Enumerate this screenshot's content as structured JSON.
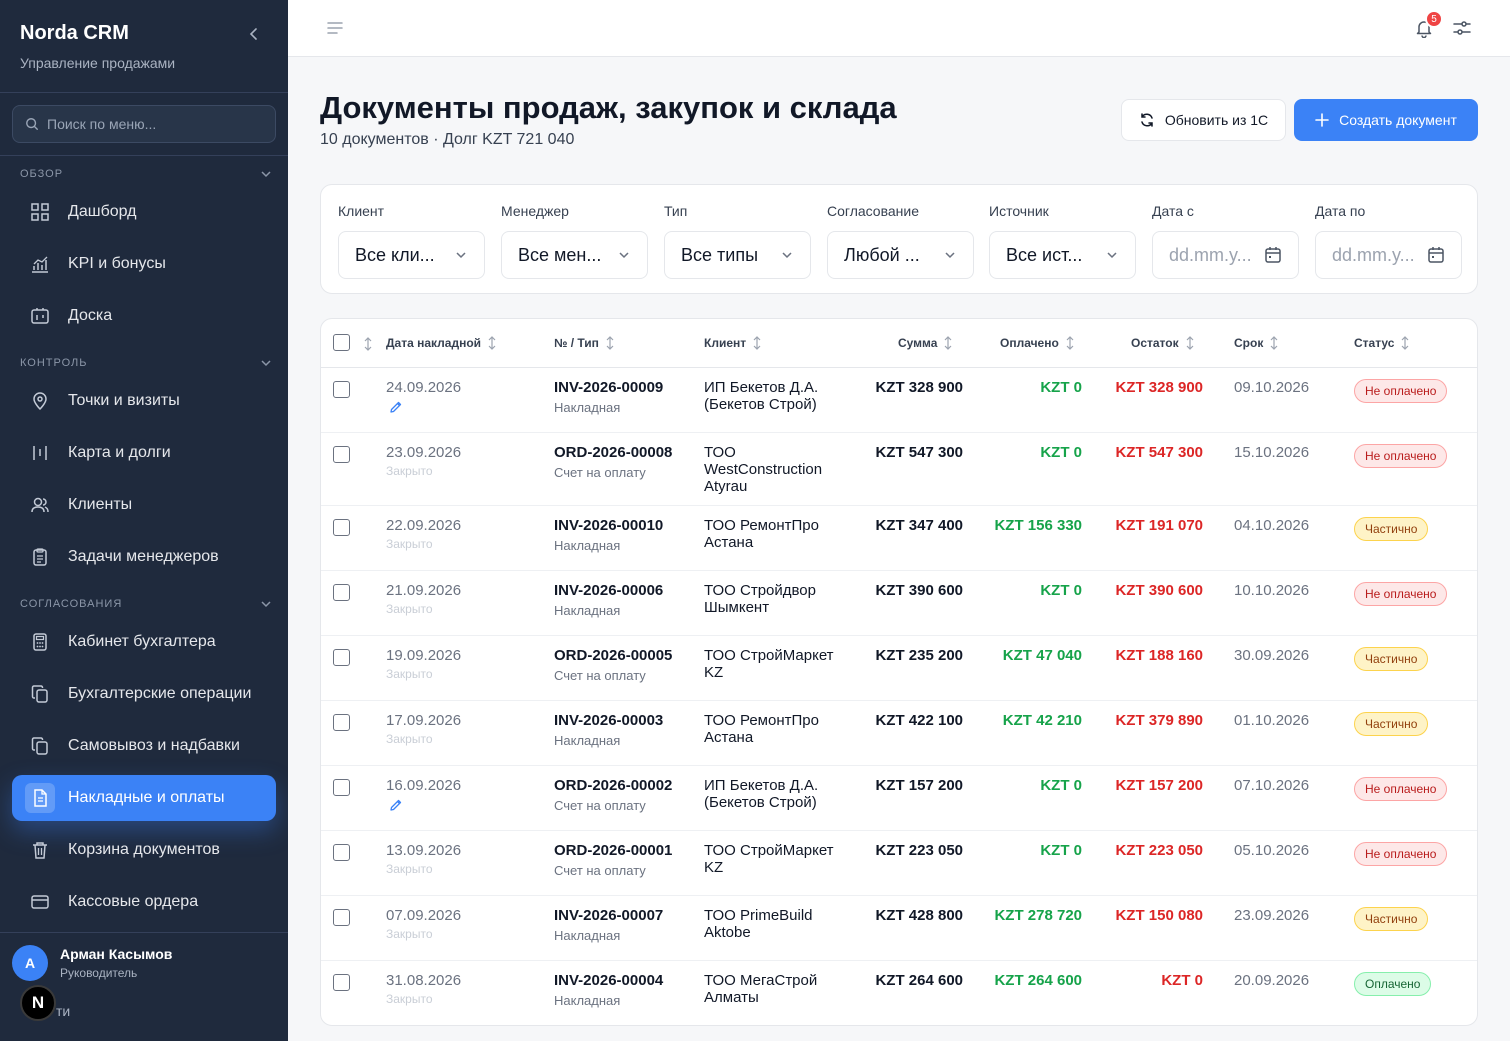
{
  "sidebar": {
    "brand_title": "Norda CRM",
    "brand_subtitle": "Управление продажами",
    "search_placeholder": "Поиск по меню...",
    "sections": {
      "overview": "ОБЗОР",
      "control": "КОНТРОЛЬ",
      "approvals": "СОГЛАСОВАНИЯ"
    },
    "items": [
      {
        "label": "Дашборд",
        "icon": "grid-icon"
      },
      {
        "label": "KPI и бонусы",
        "icon": "chart-icon"
      },
      {
        "label": "Доска",
        "icon": "board-icon"
      },
      {
        "label": "Точки и визиты",
        "icon": "map-pin-icon"
      },
      {
        "label": "Карта и долги",
        "icon": "map-icon"
      },
      {
        "label": "Клиенты",
        "icon": "users-icon"
      },
      {
        "label": "Задачи менеджеров",
        "icon": "clipboard-icon"
      },
      {
        "label": "Кабинет бухгалтера",
        "icon": "calculator-icon"
      },
      {
        "label": "Бухгалтерские операции",
        "icon": "copy-icon"
      },
      {
        "label": "Самовывоз и надбавки",
        "icon": "copy-icon"
      },
      {
        "label": "Накладные и оплаты",
        "icon": "file-icon"
      },
      {
        "label": "Корзина документов",
        "icon": "trash-icon"
      },
      {
        "label": "Кассовые ордера",
        "icon": "card-icon"
      }
    ],
    "user": {
      "initial": "А",
      "name": "Арман Касымов",
      "role": "Руководитель"
    },
    "n_badge": "N",
    "exit_text": "ти"
  },
  "topbar": {
    "notifications_count": "5"
  },
  "header": {
    "title": "Документы продаж, закупок и склада",
    "subtitle": "10 документов · Долг KZT 721 040",
    "refresh_label": "Обновить из 1С",
    "create_label": "Создать документ"
  },
  "filters": [
    {
      "label": "Клиент",
      "value": "Все кли...",
      "kind": "select"
    },
    {
      "label": "Менеджер",
      "value": "Все мен...",
      "kind": "select"
    },
    {
      "label": "Тип",
      "value": "Все типы",
      "kind": "select"
    },
    {
      "label": "Согласование",
      "value": "Любой ...",
      "kind": "select"
    },
    {
      "label": "Источник",
      "value": "Все ист...",
      "kind": "select"
    },
    {
      "label": "Дата с",
      "value": "dd.mm.y...",
      "kind": "date"
    },
    {
      "label": "Дата по",
      "value": "dd.mm.y...",
      "kind": "date"
    }
  ],
  "table": {
    "columns": {
      "date": "Дата накладной",
      "number": "№ / Тип",
      "client": "Клиент",
      "sum": "Сумма",
      "paid": "Оплачено",
      "rest": "Остаток",
      "due": "Срок",
      "status": "Статус"
    },
    "rows": [
      {
        "date": "24.09.2026",
        "sub": "",
        "edit": true,
        "number": "INV-2026-00009",
        "type": "Накладная",
        "client": "ИП Бекетов Д.А. (Бекетов Строй)",
        "sum": "KZT 328 900",
        "paid": "KZT 0",
        "rest": "KZT 328 900",
        "due": "09.10.2026",
        "status": "Не оплачено",
        "status_kind": "unpaid",
        "height": 65
      },
      {
        "date": "23.09.2026",
        "sub": "Закрыто",
        "edit": false,
        "number": "ORD-2026-00008",
        "type": "Счет на оплату",
        "client": "ТОО WestConstruction Atyrau",
        "sum": "KZT 547 300",
        "paid": "KZT 0",
        "rest": "KZT 547 300",
        "due": "15.10.2026",
        "status": "Не оплачено",
        "status_kind": "unpaid",
        "height": 73
      },
      {
        "date": "22.09.2026",
        "sub": "Закрыто",
        "edit": false,
        "number": "INV-2026-00010",
        "type": "Накладная",
        "client": "ТОО РемонтПро Астана",
        "sum": "KZT 347 400",
        "paid": "KZT 156 330",
        "rest": "KZT 191 070",
        "due": "04.10.2026",
        "status": "Частично",
        "status_kind": "partial",
        "height": 65
      },
      {
        "date": "21.09.2026",
        "sub": "Закрыто",
        "edit": false,
        "number": "INV-2026-00006",
        "type": "Накладная",
        "client": "ТОО Стройдвор Шымкент",
        "sum": "KZT 390 600",
        "paid": "KZT 0",
        "rest": "KZT 390 600",
        "due": "10.10.2026",
        "status": "Не оплачено",
        "status_kind": "unpaid",
        "height": 65
      },
      {
        "date": "19.09.2026",
        "sub": "Закрыто",
        "edit": false,
        "number": "ORD-2026-00005",
        "type": "Счет на оплату",
        "client": "ТОО СтройМаркет KZ",
        "sum": "KZT 235 200",
        "paid": "KZT 47 040",
        "rest": "KZT 188 160",
        "due": "30.09.2026",
        "status": "Частично",
        "status_kind": "partial",
        "height": 65
      },
      {
        "date": "17.09.2026",
        "sub": "Закрыто",
        "edit": false,
        "number": "INV-2026-00003",
        "type": "Накладная",
        "client": "ТОО РемонтПро Астана",
        "sum": "KZT 422 100",
        "paid": "KZT 42 210",
        "rest": "KZT 379 890",
        "due": "01.10.2026",
        "status": "Частично",
        "status_kind": "partial",
        "height": 65
      },
      {
        "date": "16.09.2026",
        "sub": "",
        "edit": true,
        "number": "ORD-2026-00002",
        "type": "Счет на оплату",
        "client": "ИП Бекетов Д.А. (Бекетов Строй)",
        "sum": "KZT 157 200",
        "paid": "KZT 0",
        "rest": "KZT 157 200",
        "due": "07.10.2026",
        "status": "Не оплачено",
        "status_kind": "unpaid",
        "height": 65
      },
      {
        "date": "13.09.2026",
        "sub": "Закрыто",
        "edit": false,
        "number": "ORD-2026-00001",
        "type": "Счет на оплату",
        "client": "ТОО СтройМаркет KZ",
        "sum": "KZT 223 050",
        "paid": "KZT 0",
        "rest": "KZT 223 050",
        "due": "05.10.2026",
        "status": "Не оплачено",
        "status_kind": "unpaid",
        "height": 65
      },
      {
        "date": "07.09.2026",
        "sub": "Закрыто",
        "edit": false,
        "number": "INV-2026-00007",
        "type": "Накладная",
        "client": "ТОО PrimeBuild Aktobe",
        "sum": "KZT 428 800",
        "paid": "KZT 278 720",
        "rest": "KZT 150 080",
        "due": "23.09.2026",
        "status": "Частично",
        "status_kind": "partial",
        "height": 65
      },
      {
        "date": "31.08.2026",
        "sub": "Закрыто",
        "edit": false,
        "number": "INV-2026-00004",
        "type": "Накладная",
        "client": "ТОО МегаСтрой Алматы",
        "sum": "KZT 264 600",
        "paid": "KZT 264 600",
        "rest": "KZT 0",
        "due": "20.09.2026",
        "status": "Оплачено",
        "status_kind": "paid",
        "height": 65
      }
    ]
  }
}
